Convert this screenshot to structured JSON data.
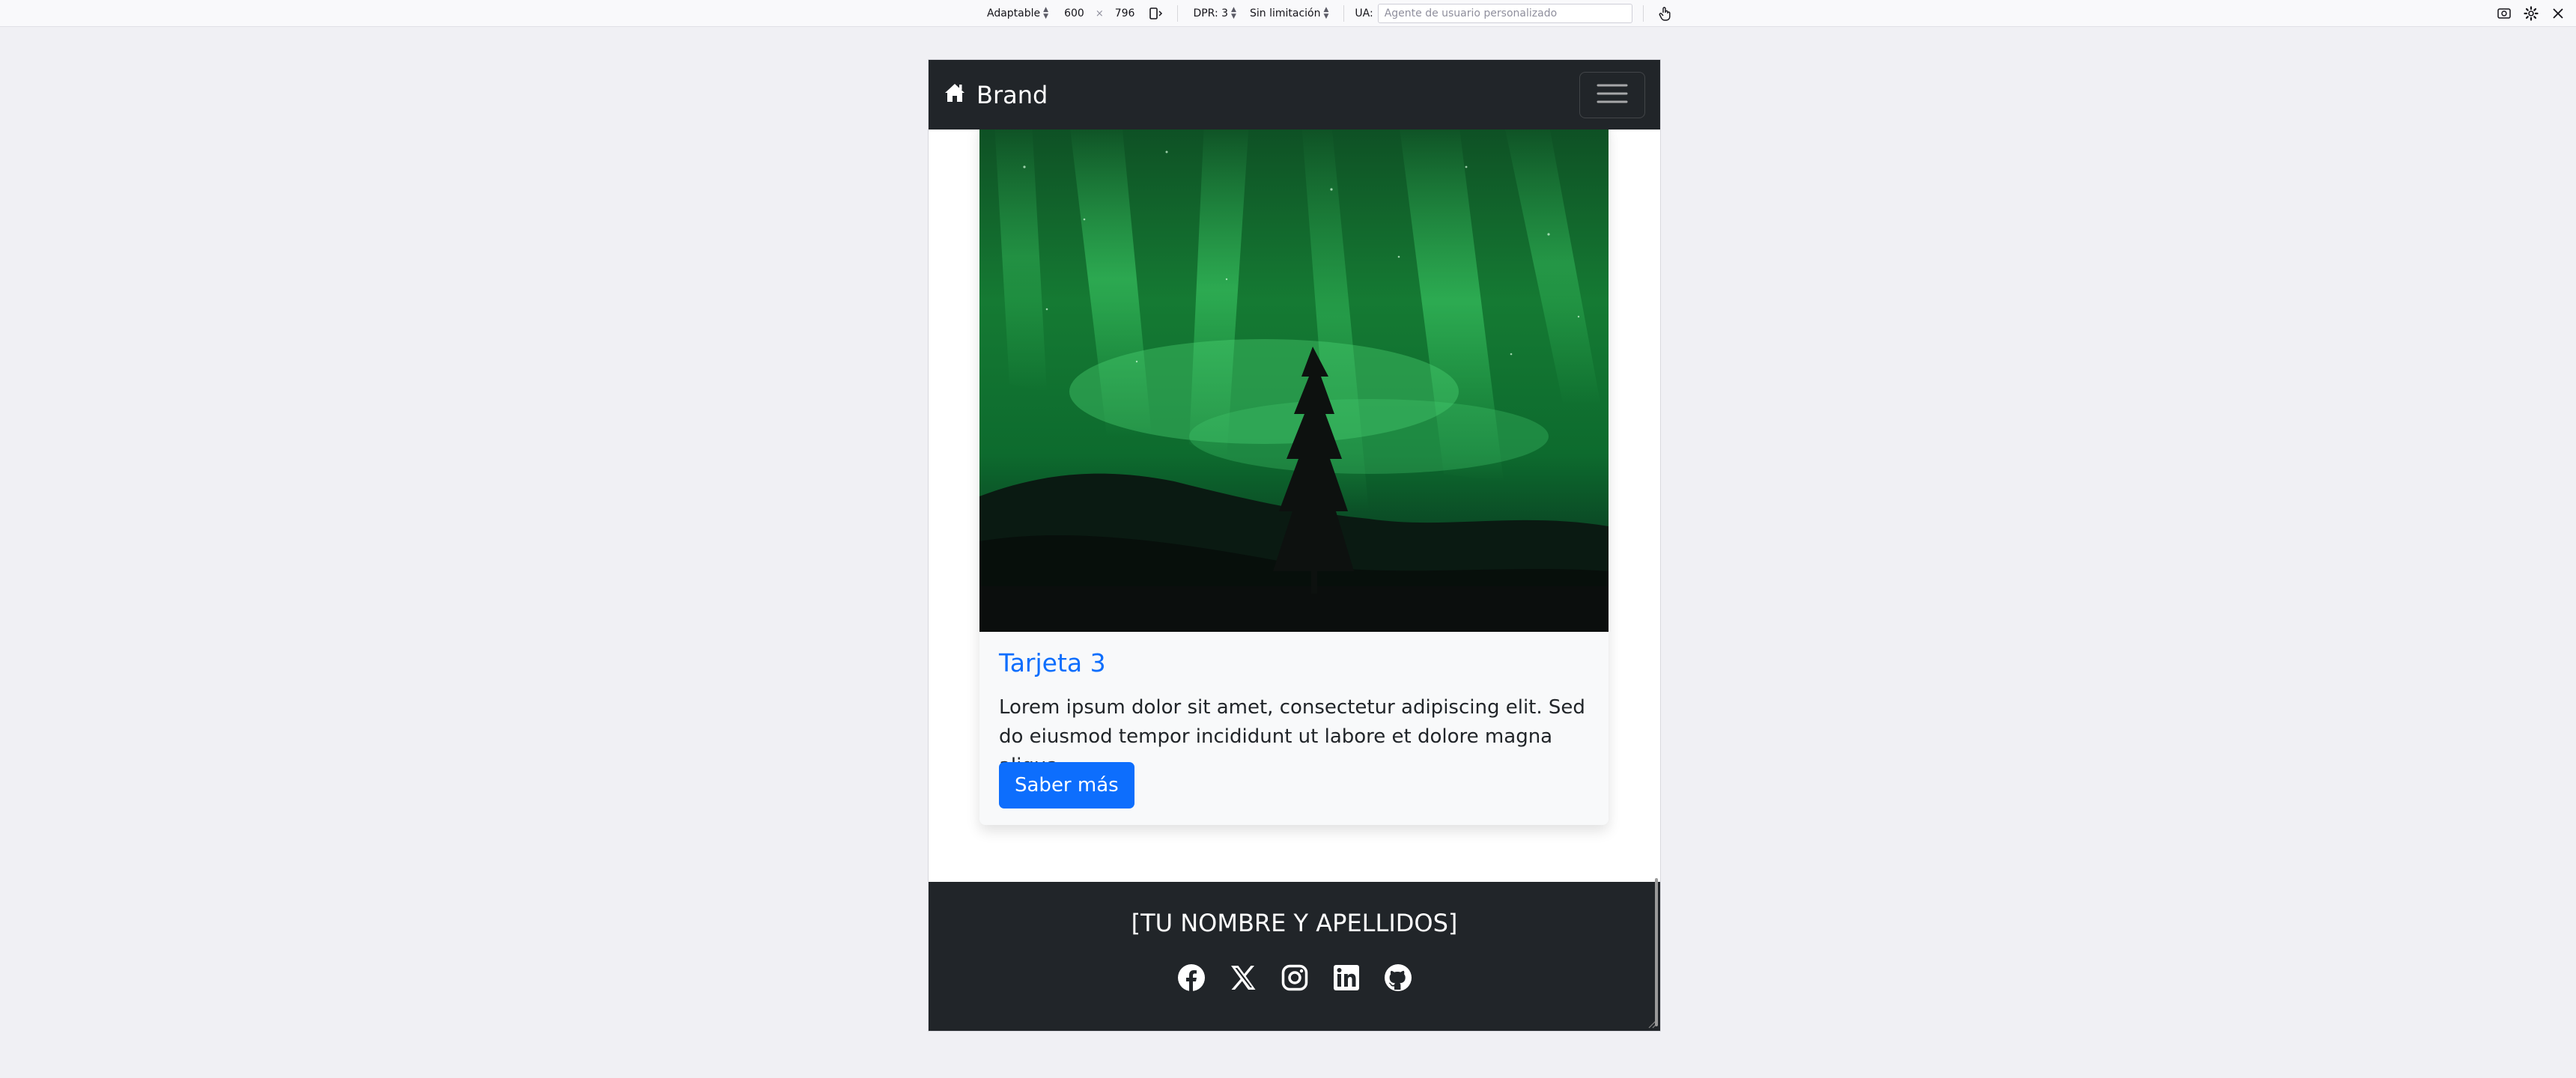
{
  "devtools": {
    "device_mode": "Adaptable",
    "width": "600",
    "times": "×",
    "height": "796",
    "dpr": "DPR: 3",
    "throttling": "Sin limitación",
    "ua_label": "UA:",
    "ua_placeholder": "Agente de usuario personalizado",
    "icons": [
      "rotate-icon",
      "touch-icon",
      "screenshot-icon",
      "settings-icon",
      "close-icon"
    ]
  },
  "navbar": {
    "brand_label": "Brand",
    "brand_icon": "house-icon",
    "toggler_icon": "hamburger-icon",
    "background": "#212529"
  },
  "card": {
    "image_description_icon": "aurora-image",
    "title": "Tarjeta 3",
    "text": "Lorem ipsum dolor sit amet, consectetur adipiscing elit. Sed do eiusmod tempor incididunt ut labore et dolore magna aliqua.",
    "button_label": "Saber más",
    "title_color": "#0d6efd",
    "button_color": "#0d6efd"
  },
  "footer": {
    "name": "[TU NOMBRE Y APELLIDOS]",
    "social_icons": [
      "facebook-icon",
      "x-icon",
      "instagram-icon",
      "linkedin-icon",
      "github-icon"
    ],
    "background": "#212529"
  }
}
